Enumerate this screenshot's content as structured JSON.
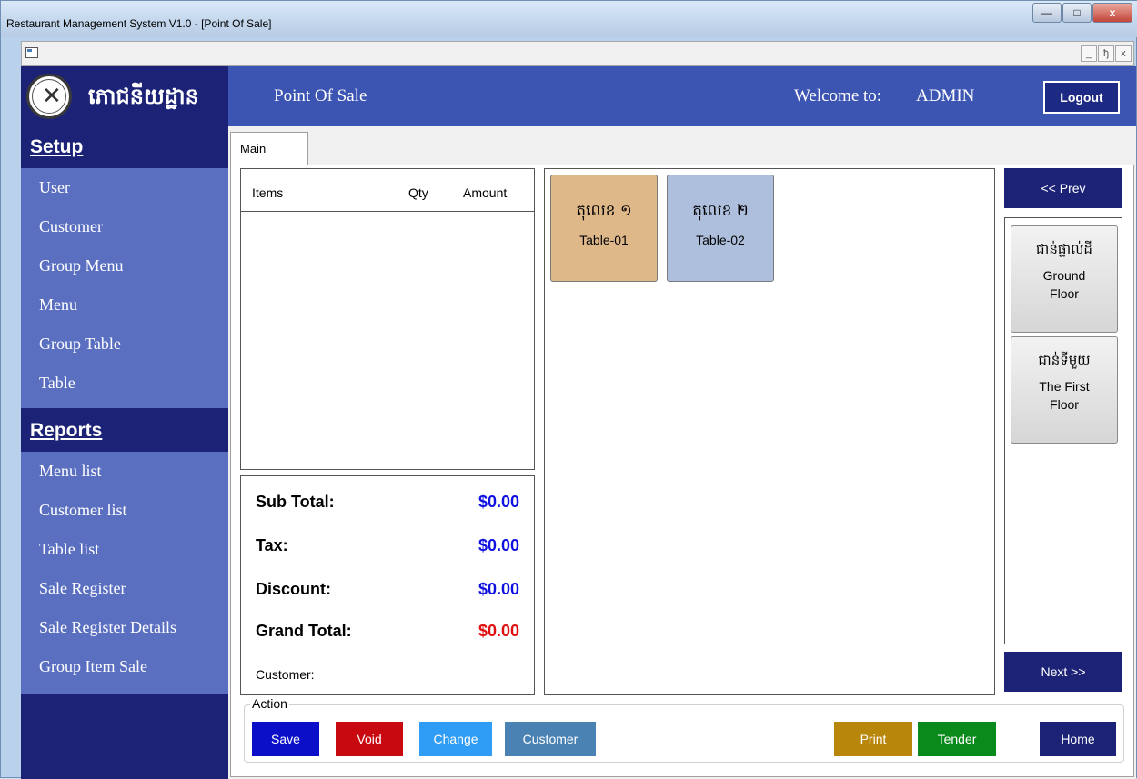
{
  "window": {
    "title": "Restaurant Management System V1.0 - [Point Of Sale]",
    "controls": [
      "—",
      "□",
      "x"
    ],
    "mdi_controls": [
      "_",
      "ђ",
      "x"
    ]
  },
  "header": {
    "brand": "ភោជនីយដ្ឋាន",
    "page_title": "Point Of Sale",
    "welcome": "Welcome to:",
    "user": "ADMIN",
    "logout_label": "Logout"
  },
  "sidebar": {
    "setup_title": "Setup",
    "setup_items": [
      "User",
      "Customer",
      "Group Menu",
      "Menu",
      "Group Table",
      "Table"
    ],
    "reports_title": "Reports",
    "report_items": [
      "Menu list",
      "Customer list",
      "Table list",
      "Sale Register",
      "Sale Register Details",
      "Group Item Sale"
    ]
  },
  "tabs": [
    "Main"
  ],
  "order": {
    "columns": [
      "Items",
      "Qty",
      "Amount"
    ],
    "rows": []
  },
  "totals": {
    "sub_total_label": "Sub Total:",
    "sub_total": "$0.00",
    "tax_label": "Tax:",
    "tax": "$0.00",
    "discount_label": "Discount:",
    "discount": "$0.00",
    "grand_total_label": "Grand Total:",
    "grand_total": "$0.00",
    "customer_label": "Customer:"
  },
  "tables": [
    {
      "kh": "តុលេខ ១",
      "en": "Table-01",
      "color": "#dfb88a"
    },
    {
      "kh": "តុលេខ ២",
      "en": "Table-02",
      "color": "#aebfdd"
    }
  ],
  "floors": {
    "prev_label": "<< Prev",
    "next_label": "Next >>",
    "items": [
      {
        "kh": "ជាន់ផ្ទាល់ដី",
        "en": "Ground Floor"
      },
      {
        "kh": "ជាន់ទីមួយ",
        "en": "The First Floor"
      }
    ]
  },
  "actions": {
    "legend": "Action",
    "save": "Save",
    "void": "Void",
    "change": "Change",
    "customer": "Customer",
    "print": "Print",
    "tender": "Tender",
    "home": "Home"
  },
  "colors": {
    "header_blue": "#3d55b2",
    "navy": "#1c2376",
    "sidebar_item_bg": "#5a6fc0",
    "total_blue": "#1010e0",
    "total_red": "#e01010",
    "save": "#0b10c8",
    "void": "#c80a10",
    "change": "#2f9cf5",
    "customer": "#4a82b4",
    "print": "#b8860b",
    "tender": "#0a8a1a",
    "home": "#1c2376"
  }
}
